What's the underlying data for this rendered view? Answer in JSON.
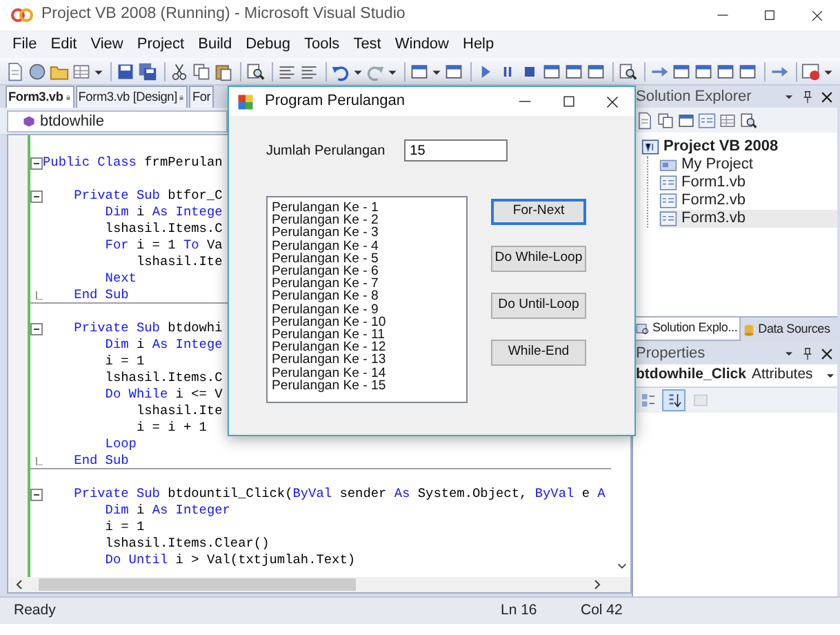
{
  "window": {
    "title": "Project VB 2008 (Running) - Microsoft Visual Studio"
  },
  "menu": [
    "File",
    "Edit",
    "View",
    "Project",
    "Build",
    "Debug",
    "Tools",
    "Test",
    "Window",
    "Help"
  ],
  "document_tabs": [
    {
      "label": "Form3.vb",
      "selected": true,
      "locked": true
    },
    {
      "label": "Form3.vb [Design]",
      "selected": false,
      "locked": true
    },
    {
      "label": "For",
      "selected": false,
      "locked": false
    }
  ],
  "member_dropdown": {
    "value": "btdowhile"
  },
  "code_lines": [
    {
      "kind": "code",
      "fold_start": true,
      "tokens": [
        {
          "kind": "keyword",
          "text": "Public Class"
        },
        {
          "kind": "plain",
          "text": " frmPerulan"
        }
      ]
    },
    {
      "kind": "blank"
    },
    {
      "kind": "code",
      "fold_start": true,
      "tokens": [
        {
          "kind": "keyword",
          "text": "    Private Sub"
        },
        {
          "kind": "plain",
          "text": " btfor_C"
        }
      ]
    },
    {
      "kind": "code",
      "tokens": [
        {
          "kind": "keyword",
          "text": "        Dim"
        },
        {
          "kind": "plain",
          "text": " i "
        },
        {
          "kind": "keyword",
          "text": "As"
        },
        {
          "kind": "keyword",
          "text": " Intege"
        }
      ]
    },
    {
      "kind": "code",
      "tokens": [
        {
          "kind": "plain",
          "text": "        lshasil.Items.C"
        }
      ]
    },
    {
      "kind": "code",
      "tokens": [
        {
          "kind": "keyword",
          "text": "        For"
        },
        {
          "kind": "plain",
          "text": " i = 1 "
        },
        {
          "kind": "keyword",
          "text": "To"
        },
        {
          "kind": "plain",
          "text": " Va"
        }
      ]
    },
    {
      "kind": "code",
      "tokens": [
        {
          "kind": "plain",
          "text": "            lshasil.Ite"
        }
      ]
    },
    {
      "kind": "code",
      "tokens": [
        {
          "kind": "keyword",
          "text": "        Next"
        }
      ]
    },
    {
      "kind": "code",
      "fold_end": true,
      "separator": true,
      "tokens": [
        {
          "kind": "keyword",
          "text": "    End Sub"
        }
      ]
    },
    {
      "kind": "blank"
    },
    {
      "kind": "code",
      "fold_start": true,
      "tokens": [
        {
          "kind": "keyword",
          "text": "    Private Sub"
        },
        {
          "kind": "plain",
          "text": " btdowhi"
        }
      ]
    },
    {
      "kind": "code",
      "tokens": [
        {
          "kind": "keyword",
          "text": "        Dim"
        },
        {
          "kind": "plain",
          "text": " i "
        },
        {
          "kind": "keyword",
          "text": "As"
        },
        {
          "kind": "keyword",
          "text": " Intege"
        }
      ]
    },
    {
      "kind": "code",
      "tokens": [
        {
          "kind": "plain",
          "text": "        i = 1"
        }
      ]
    },
    {
      "kind": "code",
      "tokens": [
        {
          "kind": "plain",
          "text": "        lshasil.Items.C"
        }
      ]
    },
    {
      "kind": "code",
      "tokens": [
        {
          "kind": "keyword",
          "text": "        Do While"
        },
        {
          "kind": "plain",
          "text": " i <= V"
        }
      ]
    },
    {
      "kind": "code",
      "tokens": [
        {
          "kind": "plain",
          "text": "            lshasil.Ite"
        }
      ]
    },
    {
      "kind": "code",
      "tokens": [
        {
          "kind": "plain",
          "text": "            i = i + 1"
        }
      ]
    },
    {
      "kind": "code",
      "tokens": [
        {
          "kind": "keyword",
          "text": "        Loop"
        }
      ]
    },
    {
      "kind": "code",
      "fold_end": true,
      "separator": true,
      "tokens": [
        {
          "kind": "keyword",
          "text": "    End Sub"
        }
      ]
    },
    {
      "kind": "blank"
    },
    {
      "kind": "code",
      "fold_start": true,
      "tokens": [
        {
          "kind": "keyword",
          "text": "    Private Sub"
        },
        {
          "kind": "plain",
          "text": " btdountil_Click("
        },
        {
          "kind": "keyword",
          "text": "ByVal"
        },
        {
          "kind": "plain",
          "text": " sender "
        },
        {
          "kind": "keyword",
          "text": "As"
        },
        {
          "kind": "plain",
          "text": " System.Object, "
        },
        {
          "kind": "keyword",
          "text": "ByVal"
        },
        {
          "kind": "plain",
          "text": " e "
        },
        {
          "kind": "keyword",
          "text": "A"
        }
      ]
    },
    {
      "kind": "code",
      "tokens": [
        {
          "kind": "keyword",
          "text": "        Dim"
        },
        {
          "kind": "plain",
          "text": " i "
        },
        {
          "kind": "keyword",
          "text": "As"
        },
        {
          "kind": "keyword",
          "text": " Integer"
        }
      ]
    },
    {
      "kind": "code",
      "tokens": [
        {
          "kind": "plain",
          "text": "        i = 1"
        }
      ]
    },
    {
      "kind": "code",
      "tokens": [
        {
          "kind": "plain",
          "text": "        lshasil.Items.Clear()"
        }
      ]
    },
    {
      "kind": "code",
      "tokens": [
        {
          "kind": "keyword",
          "text": "        Do Until"
        },
        {
          "kind": "plain",
          "text": " i > Val(txtjumlah.Text)"
        }
      ]
    }
  ],
  "solution_explorer": {
    "title": "Solution Explorer",
    "tree": [
      {
        "label": "Project VB 2008",
        "kind": "project",
        "selected": false,
        "children": [
          {
            "label": "My Project",
            "kind": "my-project",
            "selected": false
          },
          {
            "label": "Form1.vb",
            "kind": "form",
            "selected": false
          },
          {
            "label": "Form2.vb",
            "kind": "form",
            "selected": false
          },
          {
            "label": "Form3.vb",
            "kind": "form",
            "selected": true
          }
        ]
      }
    ]
  },
  "panel_tabs": [
    {
      "label": "Solution Explo...",
      "kind": "explorer",
      "selected": true
    },
    {
      "label": "Data Sources",
      "kind": "data",
      "selected": false
    }
  ],
  "properties": {
    "title": "Properties",
    "object": "btdowhile_Click",
    "type": "Attributes",
    "toolbar": [
      {
        "kind": "categorized",
        "selected": false,
        "disabled": false
      },
      {
        "kind": "alphabetical",
        "selected": true,
        "disabled": false
      },
      {
        "kind": "pages",
        "selected": false,
        "disabled": true
      }
    ]
  },
  "status_bar": {
    "text": "Ready",
    "line": "Ln 16",
    "column": "Col 42"
  },
  "dialog": {
    "title": "Program Perulangan",
    "field_label": "Jumlah Perulangan",
    "field_value": "15",
    "list_items": [
      "Perulangan Ke - 1",
      "Perulangan Ke - 2",
      "Perulangan Ke - 3",
      "Perulangan Ke - 4",
      "Perulangan Ke - 5",
      "Perulangan Ke - 6",
      "Perulangan Ke - 7",
      "Perulangan Ke - 8",
      "Perulangan Ke - 9",
      "Perulangan Ke - 10",
      "Perulangan Ke - 11",
      "Perulangan Ke - 12",
      "Perulangan Ke - 13",
      "Perulangan Ke - 14",
      "Perulangan Ke - 15"
    ],
    "buttons": [
      {
        "label": "For-Next",
        "focused": true
      },
      {
        "label": "Do While-Loop",
        "focused": false
      },
      {
        "label": "Do Until-Loop",
        "focused": false
      },
      {
        "label": "While-End",
        "focused": false
      }
    ]
  }
}
